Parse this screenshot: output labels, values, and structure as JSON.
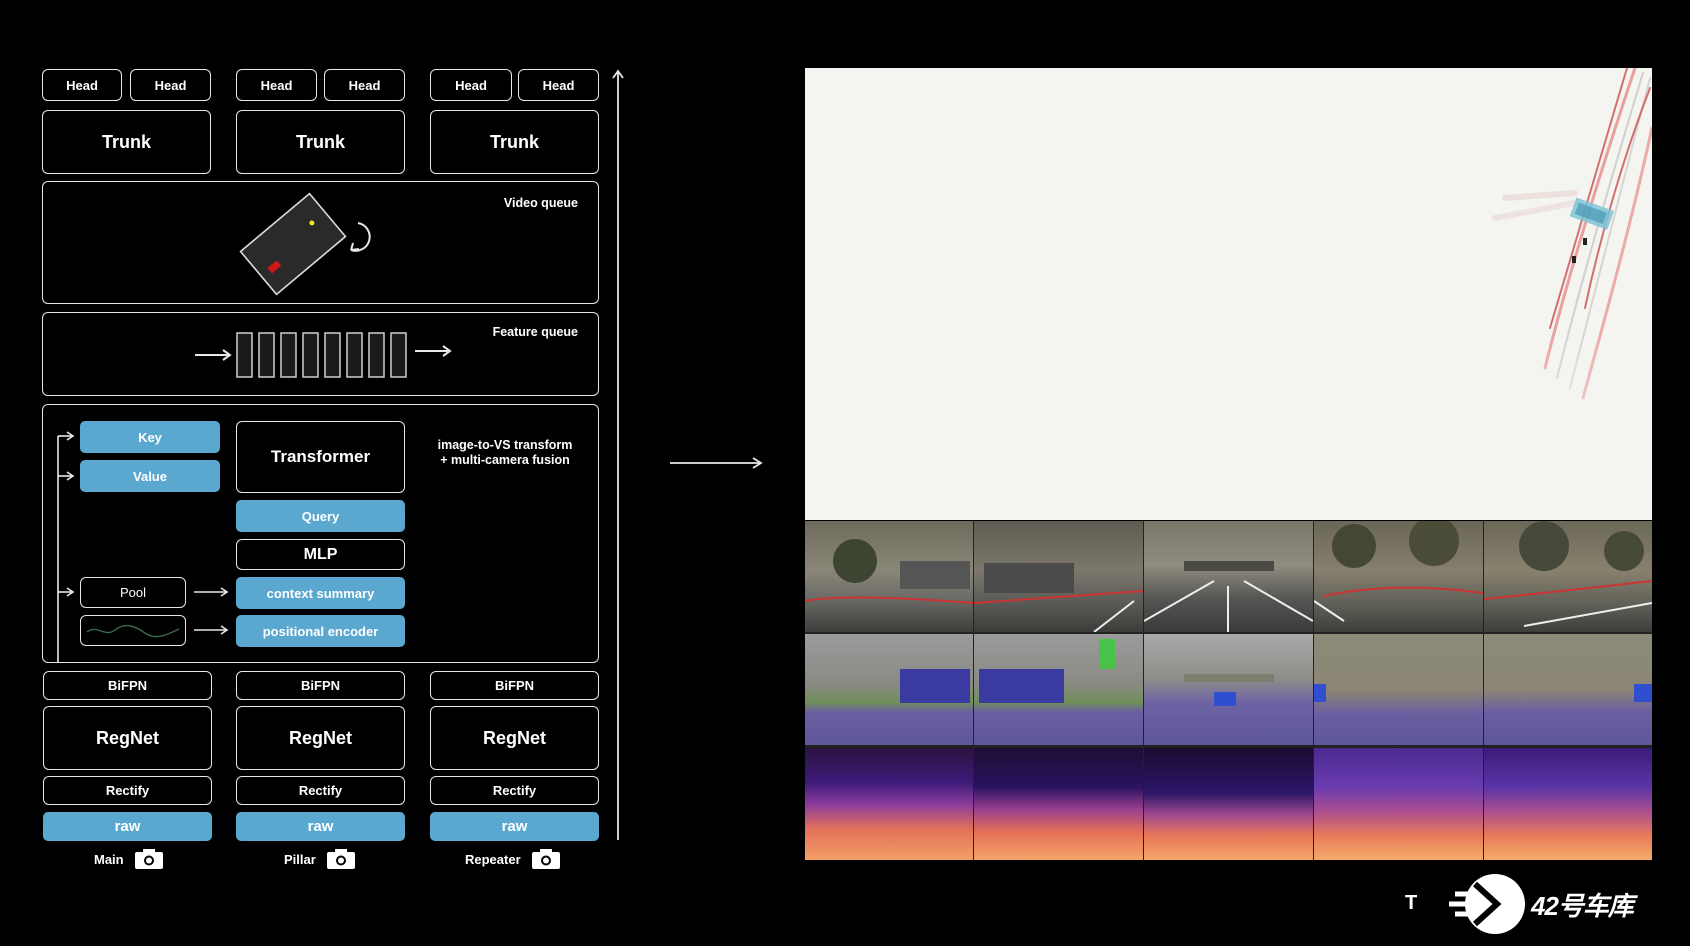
{
  "columns": [
    {
      "head_a": "Head",
      "head_b": "Head",
      "trunk": "Trunk",
      "bifpn": "BiFPN",
      "regnet": "RegNet",
      "rectify": "Rectify",
      "raw": "raw",
      "camera": "Main"
    },
    {
      "head_a": "Head",
      "head_b": "Head",
      "trunk": "Trunk",
      "bifpn": "BiFPN",
      "regnet": "RegNet",
      "rectify": "Rectify",
      "raw": "raw",
      "camera": "Pillar"
    },
    {
      "head_a": "Head",
      "head_b": "Head",
      "trunk": "Trunk",
      "bifpn": "BiFPN",
      "regnet": "RegNet",
      "rectify": "Rectify",
      "raw": "raw",
      "camera": "Repeater"
    }
  ],
  "video_queue": {
    "label": "Video queue"
  },
  "feature_queue": {
    "label": "Feature queue"
  },
  "fusion": {
    "key": "Key",
    "value": "Value",
    "transformer": "Transformer",
    "description_line1": "image-to-VS transform",
    "description_line2": "+ multi-camera fusion",
    "query": "Query",
    "mlp": "MLP",
    "pool": "Pool",
    "context_summary": "context summary",
    "positional_encoder": "positional encoder"
  },
  "watermark": {
    "glyph": "T",
    "logo_text": "42号车库"
  },
  "colors": {
    "accent_blue": "#5aa7cf",
    "line": "#e8e8e8",
    "background": "#000000"
  }
}
